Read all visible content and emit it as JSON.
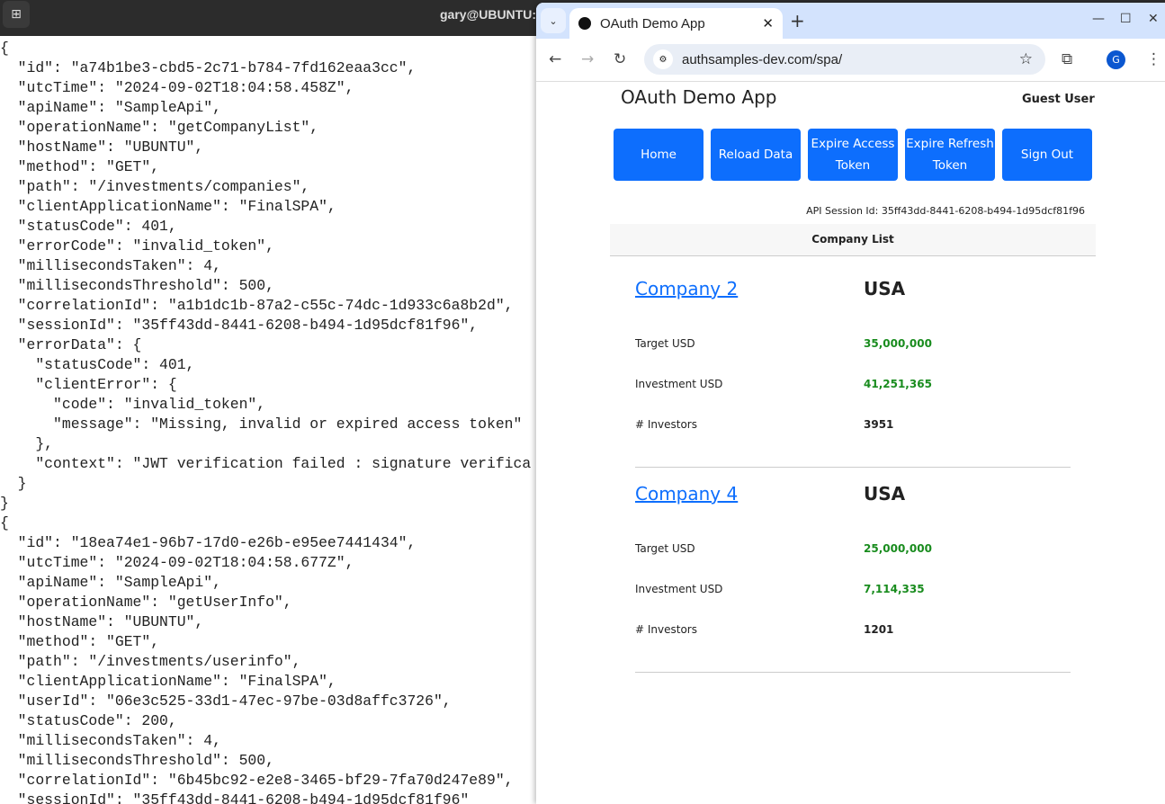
{
  "terminal": {
    "title": "gary@UBUNTU:",
    "lines": [
      "{",
      "  \"id\": \"a74b1be3-cbd5-2c71-b784-7fd162eaa3cc\",",
      "  \"utcTime\": \"2024-09-02T18:04:58.458Z\",",
      "  \"apiName\": \"SampleApi\",",
      "  \"operationName\": \"getCompanyList\",",
      "  \"hostName\": \"UBUNTU\",",
      "  \"method\": \"GET\",",
      "  \"path\": \"/investments/companies\",",
      "  \"clientApplicationName\": \"FinalSPA\",",
      "  \"statusCode\": 401,",
      "  \"errorCode\": \"invalid_token\",",
      "  \"millisecondsTaken\": 4,",
      "  \"millisecondsThreshold\": 500,",
      "  \"correlationId\": \"a1b1dc1b-87a2-c55c-74dc-1d933c6a8b2d\",",
      "  \"sessionId\": \"35ff43dd-8441-6208-b494-1d95dcf81f96\",",
      "  \"errorData\": {",
      "    \"statusCode\": 401,",
      "    \"clientError\": {",
      "      \"code\": \"invalid_token\",",
      "      \"message\": \"Missing, invalid or expired access token\"",
      "    },",
      "    \"context\": \"JWT verification failed : signature verifica",
      "  }",
      "}",
      "{",
      "  \"id\": \"18ea74e1-96b7-17d0-e26b-e95ee7441434\",",
      "  \"utcTime\": \"2024-09-02T18:04:58.677Z\",",
      "  \"apiName\": \"SampleApi\",",
      "  \"operationName\": \"getUserInfo\",",
      "  \"hostName\": \"UBUNTU\",",
      "  \"method\": \"GET\",",
      "  \"path\": \"/investments/userinfo\",",
      "  \"clientApplicationName\": \"FinalSPA\",",
      "  \"userId\": \"06e3c525-33d1-47ec-97be-03d8affc3726\",",
      "  \"statusCode\": 200,",
      "  \"millisecondsTaken\": 4,",
      "  \"millisecondsThreshold\": 500,",
      "  \"correlationId\": \"6b45bc92-e2e8-3465-bf29-7fa70d247e89\",",
      "  \"sessionId\": \"35ff43dd-8441-6208-b494-1d95dcf81f96\""
    ]
  },
  "browser": {
    "tab_title": "OAuth Demo App",
    "url": "authsamples-dev.com/spa/",
    "profile_initial": "G"
  },
  "app": {
    "title": "OAuth Demo App",
    "user": "Guest User",
    "buttons": [
      "Home",
      "Reload Data",
      "Expire Access Token",
      "Expire Refresh Token",
      "Sign Out"
    ],
    "session": "API Session Id: 35ff43dd-8441-6208-b494-1d95dcf81f96",
    "list_header": "Company List",
    "labels": {
      "target": "Target USD",
      "investment": "Investment USD",
      "investors": "# Investors"
    },
    "companies": [
      {
        "name": "Company 2",
        "country": "USA",
        "target": "35,000,000",
        "investment": "41,251,365",
        "investors": "3951"
      },
      {
        "name": "Company 4",
        "country": "USA",
        "target": "25,000,000",
        "investment": "7,114,335",
        "investors": "1201"
      }
    ],
    "colors": {
      "accent": "#0d6efd",
      "money": "#198c1e"
    }
  }
}
